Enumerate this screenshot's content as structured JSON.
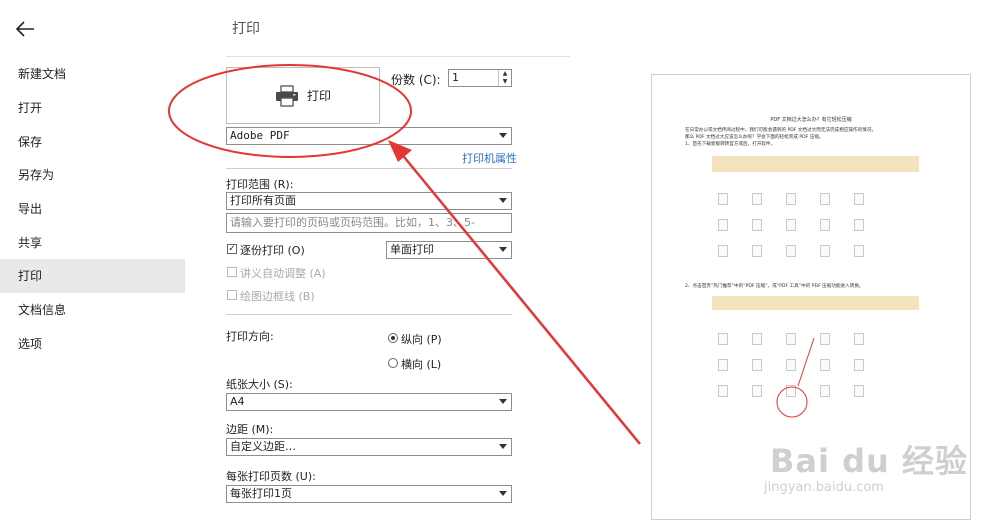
{
  "sidebar": {
    "items": [
      {
        "label": "新建文档"
      },
      {
        "label": "打开"
      },
      {
        "label": "保存"
      },
      {
        "label": "另存为"
      },
      {
        "label": "导出"
      },
      {
        "label": "共享"
      },
      {
        "label": "打印",
        "active": true
      },
      {
        "label": "文档信息"
      },
      {
        "label": "选项"
      }
    ]
  },
  "main": {
    "title": "打印",
    "print_button_label": "打印",
    "copies_label": "份数 (C):",
    "copies_value": "1",
    "printer_value": "Adobe PDF",
    "printer_properties_link": "打印机属性",
    "range_label": "打印范围 (R):",
    "range_value": "打印所有页面",
    "pages_placeholder": "请输入要打印的页码或页码范围。比如，1、3、5-",
    "collate_label": "逐份打印 (O)",
    "sides_value": "单面打印",
    "auto_adjust_label": "讲义自动调整 (A)",
    "draw_border_label": "绘图边框线 (B)",
    "orientation_label": "打印方向:",
    "portrait_label": "纵向 (P)",
    "landscape_label": "横向 (L)",
    "paper_label": "纸张大小 (S):",
    "paper_value": "A4",
    "margin_label": "边距 (M):",
    "margin_value": "自定义边距…",
    "pages_per_sheet_label": "每张打印页数 (U):",
    "pages_per_sheet_value": "每张打印1页"
  },
  "preview": {
    "doc_title": "PDF 文档过大怎么办？有它轻松压缩",
    "doc_line1": "在日常办公或文档传阅过程中，我们可能会遇到的 PDF 文档过大而无法完成相应操作的情况，",
    "doc_line2": "那么 PDF 文档过大应该怎么办呢？学会下面的轻松完成 PDF 压缩。",
    "doc_line3": "1、首先下载新版转转官方或后，打开软件。",
    "doc_line4": "2、点击首页“热门推荐”中的“PDF 压缩”，或“PDF 工具”中的 PDF 压缩功能进入转换。",
    "watermark_big": "Bai du 经验",
    "watermark_small": "jingyan.baidu.com"
  },
  "colors": {
    "accent_link": "#2a72c9",
    "annotation_red": "#e53535",
    "active_sidebar": "#e9e9e9"
  }
}
